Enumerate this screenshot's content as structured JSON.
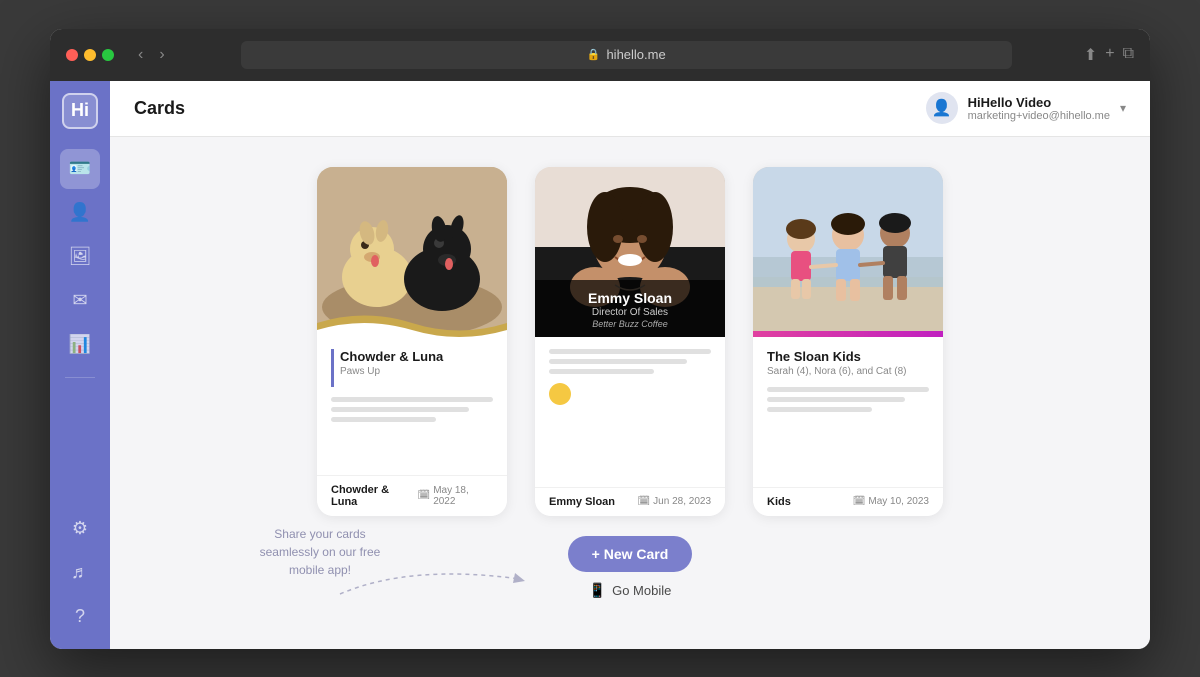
{
  "browser": {
    "url": "hihello.me",
    "back_btn": "‹",
    "forward_btn": "›"
  },
  "header": {
    "title": "Cards",
    "user_name": "HiHello Video",
    "user_email": "marketing+video@hihello.me"
  },
  "sidebar": {
    "logo_text": "Hi",
    "items": [
      {
        "id": "cards",
        "icon": "🪪",
        "label": "Cards",
        "active": true
      },
      {
        "id": "contacts",
        "icon": "👤",
        "label": "Contacts",
        "active": false
      },
      {
        "id": "gallery",
        "icon": "🖼",
        "label": "Gallery",
        "active": false
      },
      {
        "id": "mail",
        "icon": "✉",
        "label": "Mail",
        "active": false
      },
      {
        "id": "analytics",
        "icon": "📊",
        "label": "Analytics",
        "active": false
      }
    ],
    "bottom_items": [
      {
        "id": "settings",
        "icon": "⚙",
        "label": "Settings"
      },
      {
        "id": "spotify",
        "icon": "♬",
        "label": "Spotify"
      },
      {
        "id": "help",
        "icon": "?",
        "label": "Help"
      }
    ]
  },
  "cards": [
    {
      "id": "chowder-luna",
      "image_type": "dogs",
      "name": "Chowder & Luna",
      "subtitle": "Paws Up",
      "footer_name": "Chowder & Luna",
      "date": "May 18, 2022",
      "has_accent": true
    },
    {
      "id": "emmy-sloan",
      "image_type": "emmy",
      "name": "Emmy Sloan",
      "overlay_name": "Emmy Sloan",
      "overlay_title": "Director Of Sales",
      "overlay_company": "Better Buzz Coffee",
      "subtitle": "",
      "footer_name": "Emmy Sloan",
      "date": "Jun 28, 2023",
      "has_overlay": true,
      "has_avatar": true
    },
    {
      "id": "sloan-kids",
      "image_type": "kids",
      "name": "The Sloan Kids",
      "subtitle": "Sarah (4), Nora (6), and Cat (8)",
      "footer_name": "Kids",
      "date": "May 10, 2023",
      "has_accent_bar": true
    }
  ],
  "actions": {
    "new_card_label": "+ New Card",
    "go_mobile_label": "Go Mobile",
    "share_text": "Share your cards seamlessly on our free mobile app!"
  }
}
